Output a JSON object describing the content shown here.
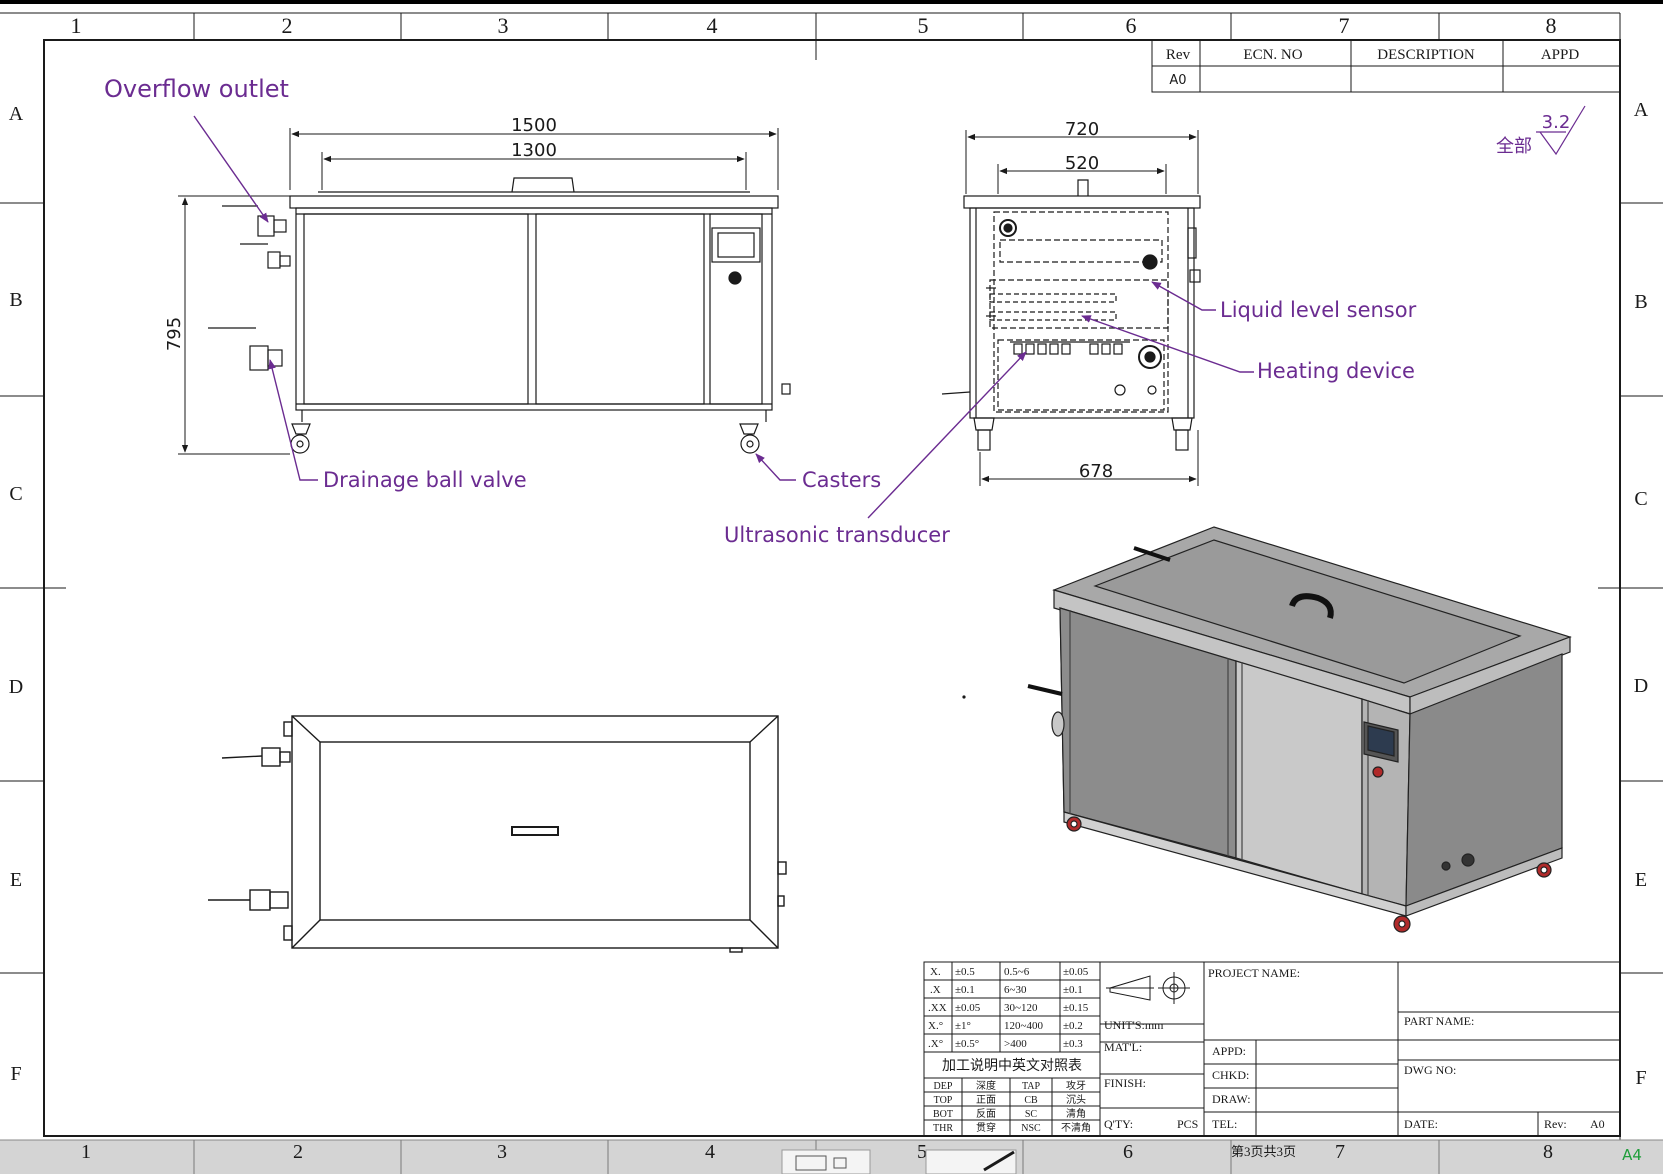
{
  "colors": {
    "annotation": "#6b2c91",
    "line": "#1a1a1a",
    "panel_dark": "#8e8e8e",
    "panel_light": "#bdbdbd",
    "top": "#a9a9a9",
    "caster_red": "#b02a2a",
    "sheet_size": "#1e9e3a"
  },
  "grid": {
    "columns": [
      "1",
      "2",
      "3",
      "4",
      "5",
      "6",
      "7",
      "8"
    ],
    "rows": [
      "A",
      "B",
      "C",
      "D",
      "E",
      "F"
    ]
  },
  "revision_table": {
    "headers": [
      "Rev",
      "ECN. NO",
      "DESCRIPTION",
      "APPD"
    ],
    "row": [
      "A0",
      "",
      "",
      ""
    ]
  },
  "surface_finish": {
    "value": "3.2",
    "note": "全部"
  },
  "front_view": {
    "dim_overall_length": "1500",
    "dim_inner_length": "1300",
    "dim_height": "795"
  },
  "side_view": {
    "dim_overall_width": "720",
    "dim_inner_width": "520",
    "dim_caster_span": "678"
  },
  "callouts": {
    "overflow_outlet": "Overflow outlet",
    "drainage_ball_valve": "Drainage ball valve",
    "casters": "Casters",
    "ultrasonic_transducer": "Ultrasonic transducer",
    "liquid_level_sensor": "Liquid level sensor",
    "heating_device": "Heating device"
  },
  "title_block": {
    "tolerances": [
      [
        "X.",
        "±0.5",
        "0.5~6",
        "±0.05"
      ],
      [
        ".X",
        "±0.1",
        "6~30",
        "±0.1"
      ],
      [
        ".XX",
        "±0.05",
        "30~120",
        "±0.15"
      ],
      [
        "X.°",
        "±1°",
        "120~400",
        "±0.2"
      ],
      [
        ".X°",
        "±0.5°",
        ">400",
        "±0.3"
      ]
    ],
    "units": "UNIT'S:mm",
    "material": "MAT'L:",
    "finish": "FINISH:",
    "qty": "Q'TY:",
    "pcs": "PCS",
    "process_title": "加工说明中英文对照表",
    "process_table": [
      [
        "DEP",
        "深度",
        "TAP",
        "攻牙"
      ],
      [
        "TOP",
        "正面",
        "CB",
        "沉头"
      ],
      [
        "BOT",
        "反面",
        "SC",
        "清角"
      ],
      [
        "THR",
        "贯穿",
        "NSC",
        "不清角"
      ]
    ],
    "project_name": "PROJECT NAME:",
    "part_name": "PART NAME:",
    "dwg_no": "DWG NO:",
    "appd": "APPD:",
    "chkd": "CHKD:",
    "draw": "DRAW:",
    "tel": "TEL:",
    "date": "DATE:",
    "rev": "Rev:",
    "rev_value": "A0"
  },
  "footer": {
    "page_info": "第3页共3页",
    "sheet_size": "A4"
  }
}
